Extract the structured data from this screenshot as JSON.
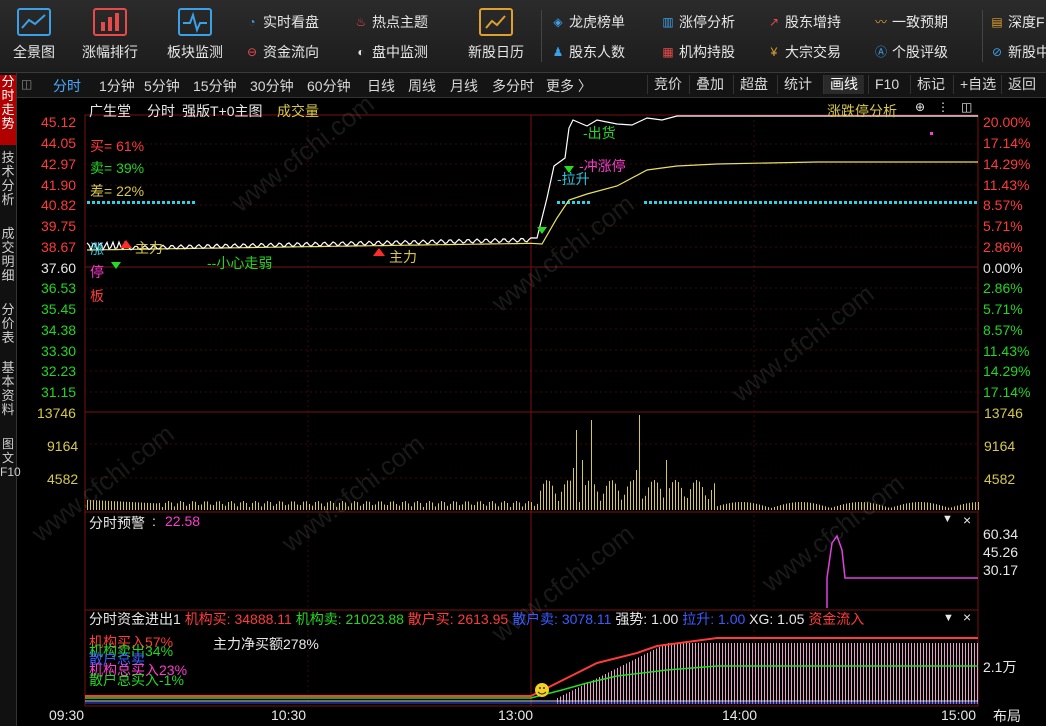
{
  "toolbar": {
    "big": [
      {
        "label": "全景图",
        "icon": "panorama-icon"
      },
      {
        "label": "涨幅排行",
        "icon": "bar-ranking-icon"
      },
      {
        "label": "板块监测",
        "icon": "sector-monitor-icon"
      },
      {
        "label": "新股日历",
        "icon": "calendar-icon"
      }
    ],
    "small": [
      {
        "label": "实时看盘",
        "icon": "realtime-icon"
      },
      {
        "label": "热点主题",
        "icon": "fire-icon"
      },
      {
        "label": "资金流向",
        "icon": "money-flow-icon"
      },
      {
        "label": "盘中监测",
        "icon": "intraday-monitor-icon"
      },
      {
        "label": "龙虎榜单",
        "icon": "dragon-tiger-icon"
      },
      {
        "label": "股东人数",
        "icon": "shareholders-icon"
      },
      {
        "label": "涨停分析",
        "icon": "limit-up-icon"
      },
      {
        "label": "机构持股",
        "icon": "institution-icon"
      },
      {
        "label": "股东增持",
        "icon": "increase-icon"
      },
      {
        "label": "大宗交易",
        "icon": "block-trade-icon"
      },
      {
        "label": "一致预期",
        "icon": "consensus-icon"
      },
      {
        "label": "个股评级",
        "icon": "rating-icon"
      },
      {
        "label": "深度F",
        "icon": "depth-icon"
      },
      {
        "label": "新股中",
        "icon": "newstock-icon"
      }
    ]
  },
  "left_tabs": [
    "分时走势",
    "技术分析",
    "成交明细",
    "分价表",
    "基本资料",
    "图文F10"
  ],
  "period_bar": {
    "items": [
      "分时",
      "1分钟",
      "5分钟",
      "15分钟",
      "30分钟",
      "60分钟",
      "日线",
      "周线",
      "月线",
      "多分时",
      "更多 〉"
    ],
    "buttons": [
      "竞价",
      "叠加",
      "超盘",
      "统计",
      "画线",
      "F10",
      "标记",
      "+自选",
      "返回"
    ]
  },
  "chart_header": {
    "stock_name": "广生堂",
    "mode": "分时",
    "indicator": "强版T+0主图",
    "volume_label": "成交量",
    "right_link": "涨跌停分析"
  },
  "stats": {
    "buy": "买= 61%",
    "sell": "卖= 39%",
    "diff": "差= 22%"
  },
  "annotations": {
    "zhuli1": "主力",
    "zhuli2": "主力",
    "xiaoxin": "--小心走弱",
    "lashen": "-拉升",
    "chongzhangting": "-冲涨停",
    "chuhuo": "-出货",
    "zhang": "涨",
    "ting": "停",
    "ban": "板"
  },
  "price_axis": {
    "left": [
      "45.12",
      "44.05",
      "42.97",
      "41.90",
      "40.82",
      "39.75",
      "38.67",
      "37.60",
      "36.53",
      "35.45",
      "34.38",
      "33.30",
      "32.23",
      "31.15"
    ],
    "right": [
      "20.00%",
      "17.14%",
      "14.29%",
      "11.43%",
      "8.57%",
      "5.71%",
      "2.86%",
      "0.00%",
      "2.86%",
      "5.71%",
      "8.57%",
      "11.43%",
      "14.29%",
      "17.14%"
    ]
  },
  "volume_axis": [
    "13746",
    "9164",
    "4582"
  ],
  "warning_panel": {
    "title": "分时预警",
    "value": "22.58",
    "axis": [
      "60.34",
      "45.26",
      "30.17"
    ]
  },
  "fund_panel": {
    "title": "分时资金进出1",
    "inst_buy": "机构买: 34888.11",
    "inst_sell": "机构卖: 21023.88",
    "retail_buy": "散户买: 2613.95",
    "retail_sell": "散户卖: 3078.11",
    "strength": "强势: 1.00",
    "lashen": "拉升: 1.00",
    "xg": "XG: 1.05",
    "inflow": "资金流入",
    "net_buy": "主力净买额278%",
    "inst_buy_in": "机构买入57%",
    "inst_sell_out": "机构卖出34%",
    "retail_total_buy": "散户总买入-1%",
    "axis": "2.1万",
    "overlap1": "散户总卖",
    "overlap2": "机构总买入23%"
  },
  "time_axis": [
    "09:30",
    "10:30",
    "13:00",
    "14:00",
    "15:00"
  ],
  "corner_button": "布局",
  "watermark": "www.cfchi.com",
  "chart_data": {
    "type": "line",
    "prev_close": 37.6,
    "x": [
      "09:30",
      "10:30",
      "13:00",
      "14:00",
      "15:00"
    ],
    "ylim": [
      31.15,
      45.12
    ],
    "series": [],
    "volume_ylim": [
      0,
      13746
    ]
  }
}
